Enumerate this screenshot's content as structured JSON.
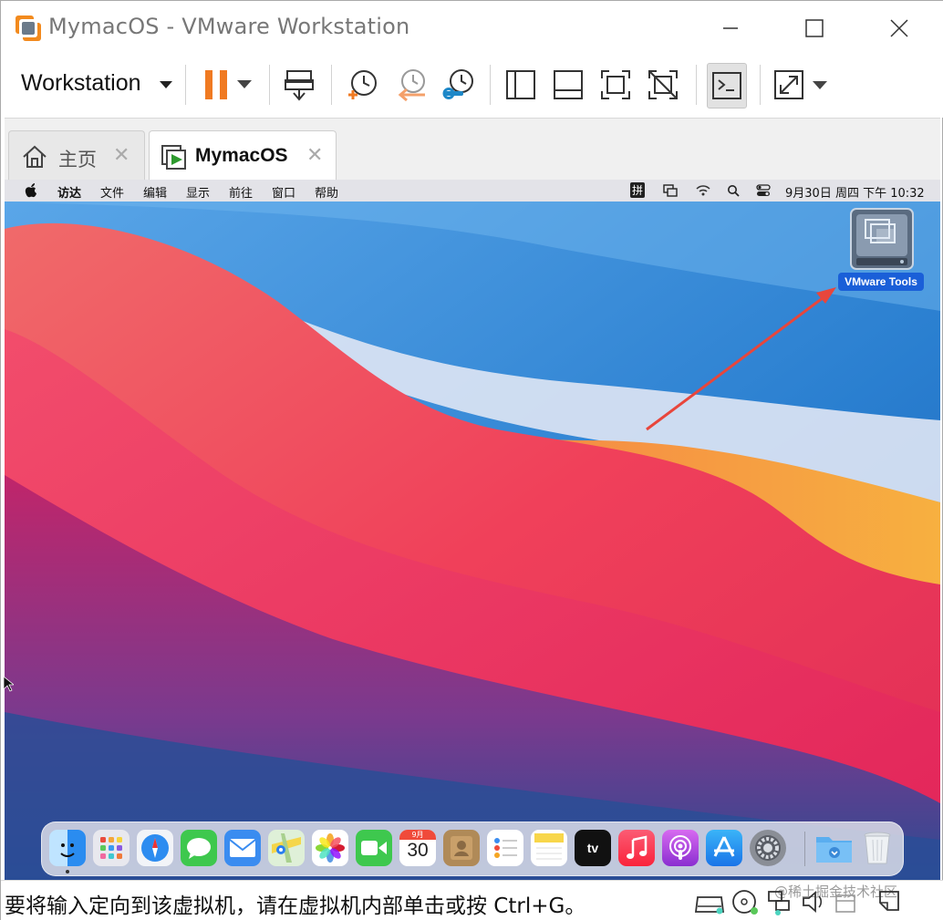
{
  "window": {
    "title": "MymacOS - VMware Workstation"
  },
  "toolbar": {
    "menu_label": "Workstation",
    "buttons": [
      "power-pause",
      "power-dropdown",
      "send-ctrl-alt-del",
      "take-snapshot",
      "revert-snapshot",
      "snapshot-manager",
      "show-library",
      "show-thumbnail-bar",
      "full-screen",
      "unity",
      "console-view",
      "stretch-guest"
    ]
  },
  "tabs": [
    {
      "label": "主页",
      "close": "✕",
      "selected": false
    },
    {
      "label": "MymacOS",
      "close": "✕",
      "selected": true
    }
  ],
  "guest": {
    "menubar": {
      "items": [
        "访达",
        "文件",
        "编辑",
        "显示",
        "前往",
        "窗口",
        "帮助"
      ],
      "input_method": "拼",
      "clock": "9月30日 周四 下午 10:32"
    },
    "desktop_icon": {
      "label": "VMware Tools"
    },
    "dock": {
      "apps": [
        "finder",
        "launchpad",
        "safari",
        "messages",
        "mail",
        "maps",
        "photos",
        "facetime",
        "calendar",
        "contacts",
        "reminders",
        "notes",
        "apple-tv",
        "music",
        "podcasts",
        "app-store",
        "system-preferences",
        "downloads",
        "trash"
      ],
      "calendar_month": "9月",
      "calendar_day": "30",
      "tv_label": "tv"
    }
  },
  "statusbar": {
    "message": "要将输入定向到该虚拟机，请在虚拟机内部单击或按 Ctrl+G。",
    "watermark": "@稀土掘金技术社区"
  },
  "colors": {
    "accent_orange": "#f07a22",
    "selection_blue": "#1a5fd8",
    "annotation_red": "#e8463c"
  }
}
